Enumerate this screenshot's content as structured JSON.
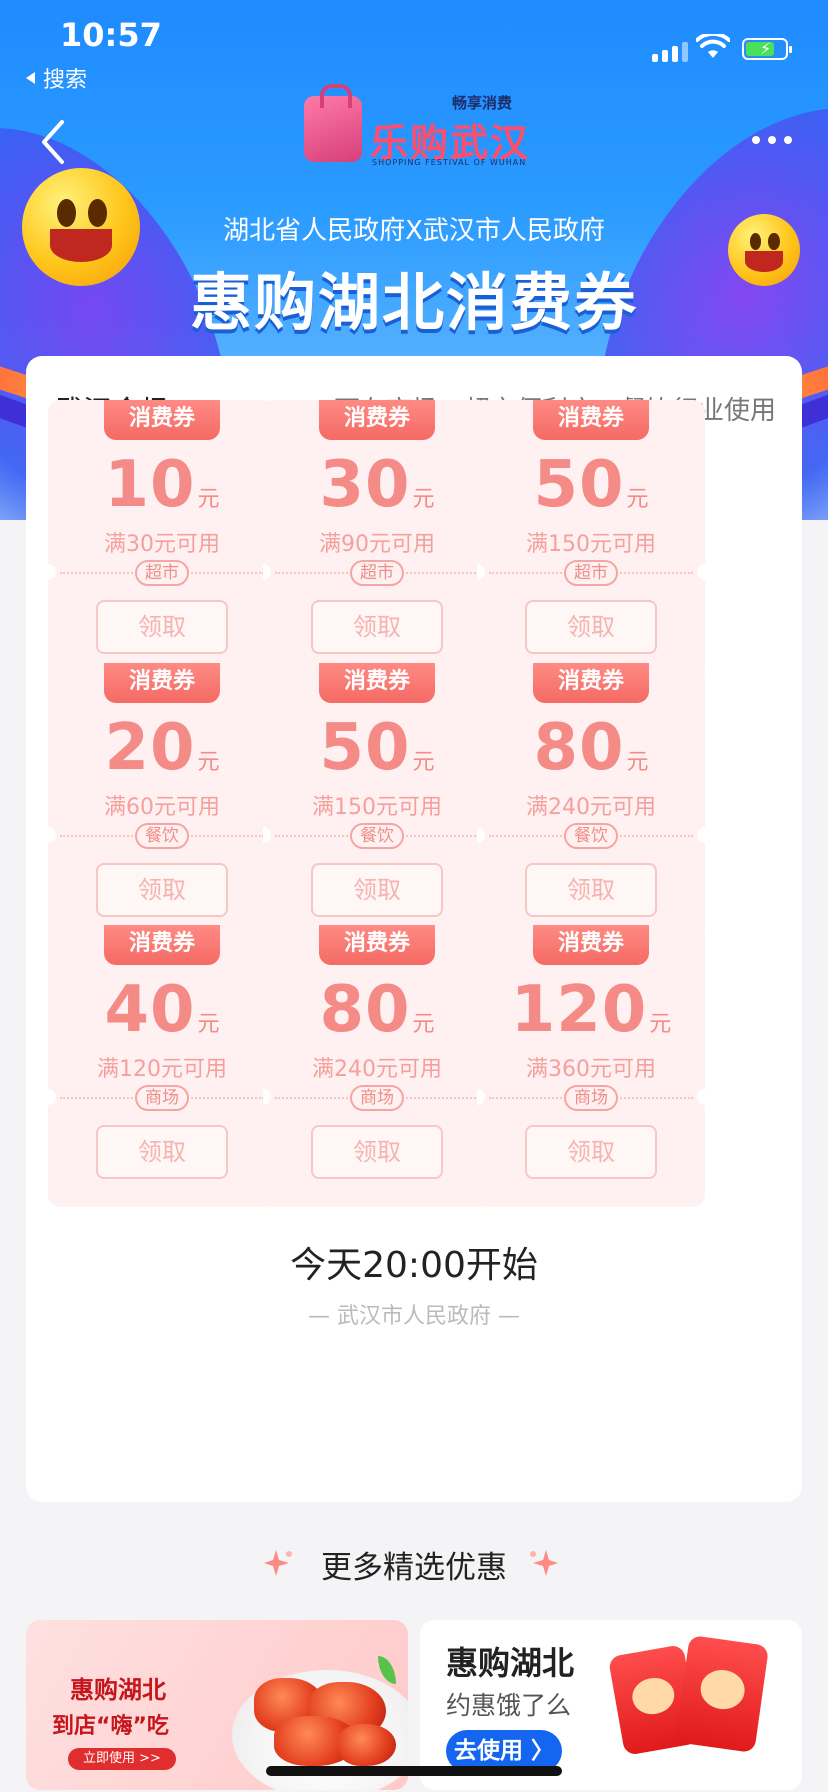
{
  "status_bar": {
    "time": "10:57",
    "back_app": "搜索"
  },
  "header": {
    "logo_tag": "畅享消费",
    "logo_name": "乐购武汉",
    "logo_sub": "SHOPPING FESTIVAL OF WUHAN",
    "gov_line": "湖北省人民政府X武汉市人民政府",
    "headline": "惠购湖北消费券"
  },
  "card": {
    "venue": "武汉会场",
    "usage": "可在商场、超市便利店、餐饮行业使用",
    "coupons": [
      {
        "ribbon": "消费券",
        "amount": "10",
        "unit": "元",
        "condition": "满30元可用",
        "category": "超市",
        "claim": "领取"
      },
      {
        "ribbon": "消费券",
        "amount": "30",
        "unit": "元",
        "condition": "满90元可用",
        "category": "超市",
        "claim": "领取"
      },
      {
        "ribbon": "消费券",
        "amount": "50",
        "unit": "元",
        "condition": "满150元可用",
        "category": "超市",
        "claim": "领取"
      },
      {
        "ribbon": "消费券",
        "amount": "20",
        "unit": "元",
        "condition": "满60元可用",
        "category": "餐饮",
        "claim": "领取"
      },
      {
        "ribbon": "消费券",
        "amount": "50",
        "unit": "元",
        "condition": "满150元可用",
        "category": "餐饮",
        "claim": "领取"
      },
      {
        "ribbon": "消费券",
        "amount": "80",
        "unit": "元",
        "condition": "满240元可用",
        "category": "餐饮",
        "claim": "领取"
      },
      {
        "ribbon": "消费券",
        "amount": "40",
        "unit": "元",
        "condition": "满120元可用",
        "category": "商场",
        "claim": "领取"
      },
      {
        "ribbon": "消费券",
        "amount": "80",
        "unit": "元",
        "condition": "满240元可用",
        "category": "商场",
        "claim": "领取"
      },
      {
        "ribbon": "消费券",
        "amount": "120",
        "unit": "元",
        "condition": "满360元可用",
        "category": "商场",
        "claim": "领取"
      }
    ],
    "start_text": "今天20:00开始",
    "footer": "— 武汉市人民政府 —"
  },
  "more": {
    "title": "更多精选优惠",
    "left_promo": {
      "line1": "惠购湖北",
      "line2": "到店“嗨”吃",
      "button": "立即使用 >>"
    },
    "right_promo": {
      "title": "惠购湖北",
      "subtitle": "约惠饿了么",
      "button": "去使用 〉"
    }
  },
  "colors": {
    "banner_blue": "#1f8bff",
    "coupon_pink": "#f58b86",
    "ribbon_red": "#f56a64",
    "action_blue": "#1466f0"
  }
}
